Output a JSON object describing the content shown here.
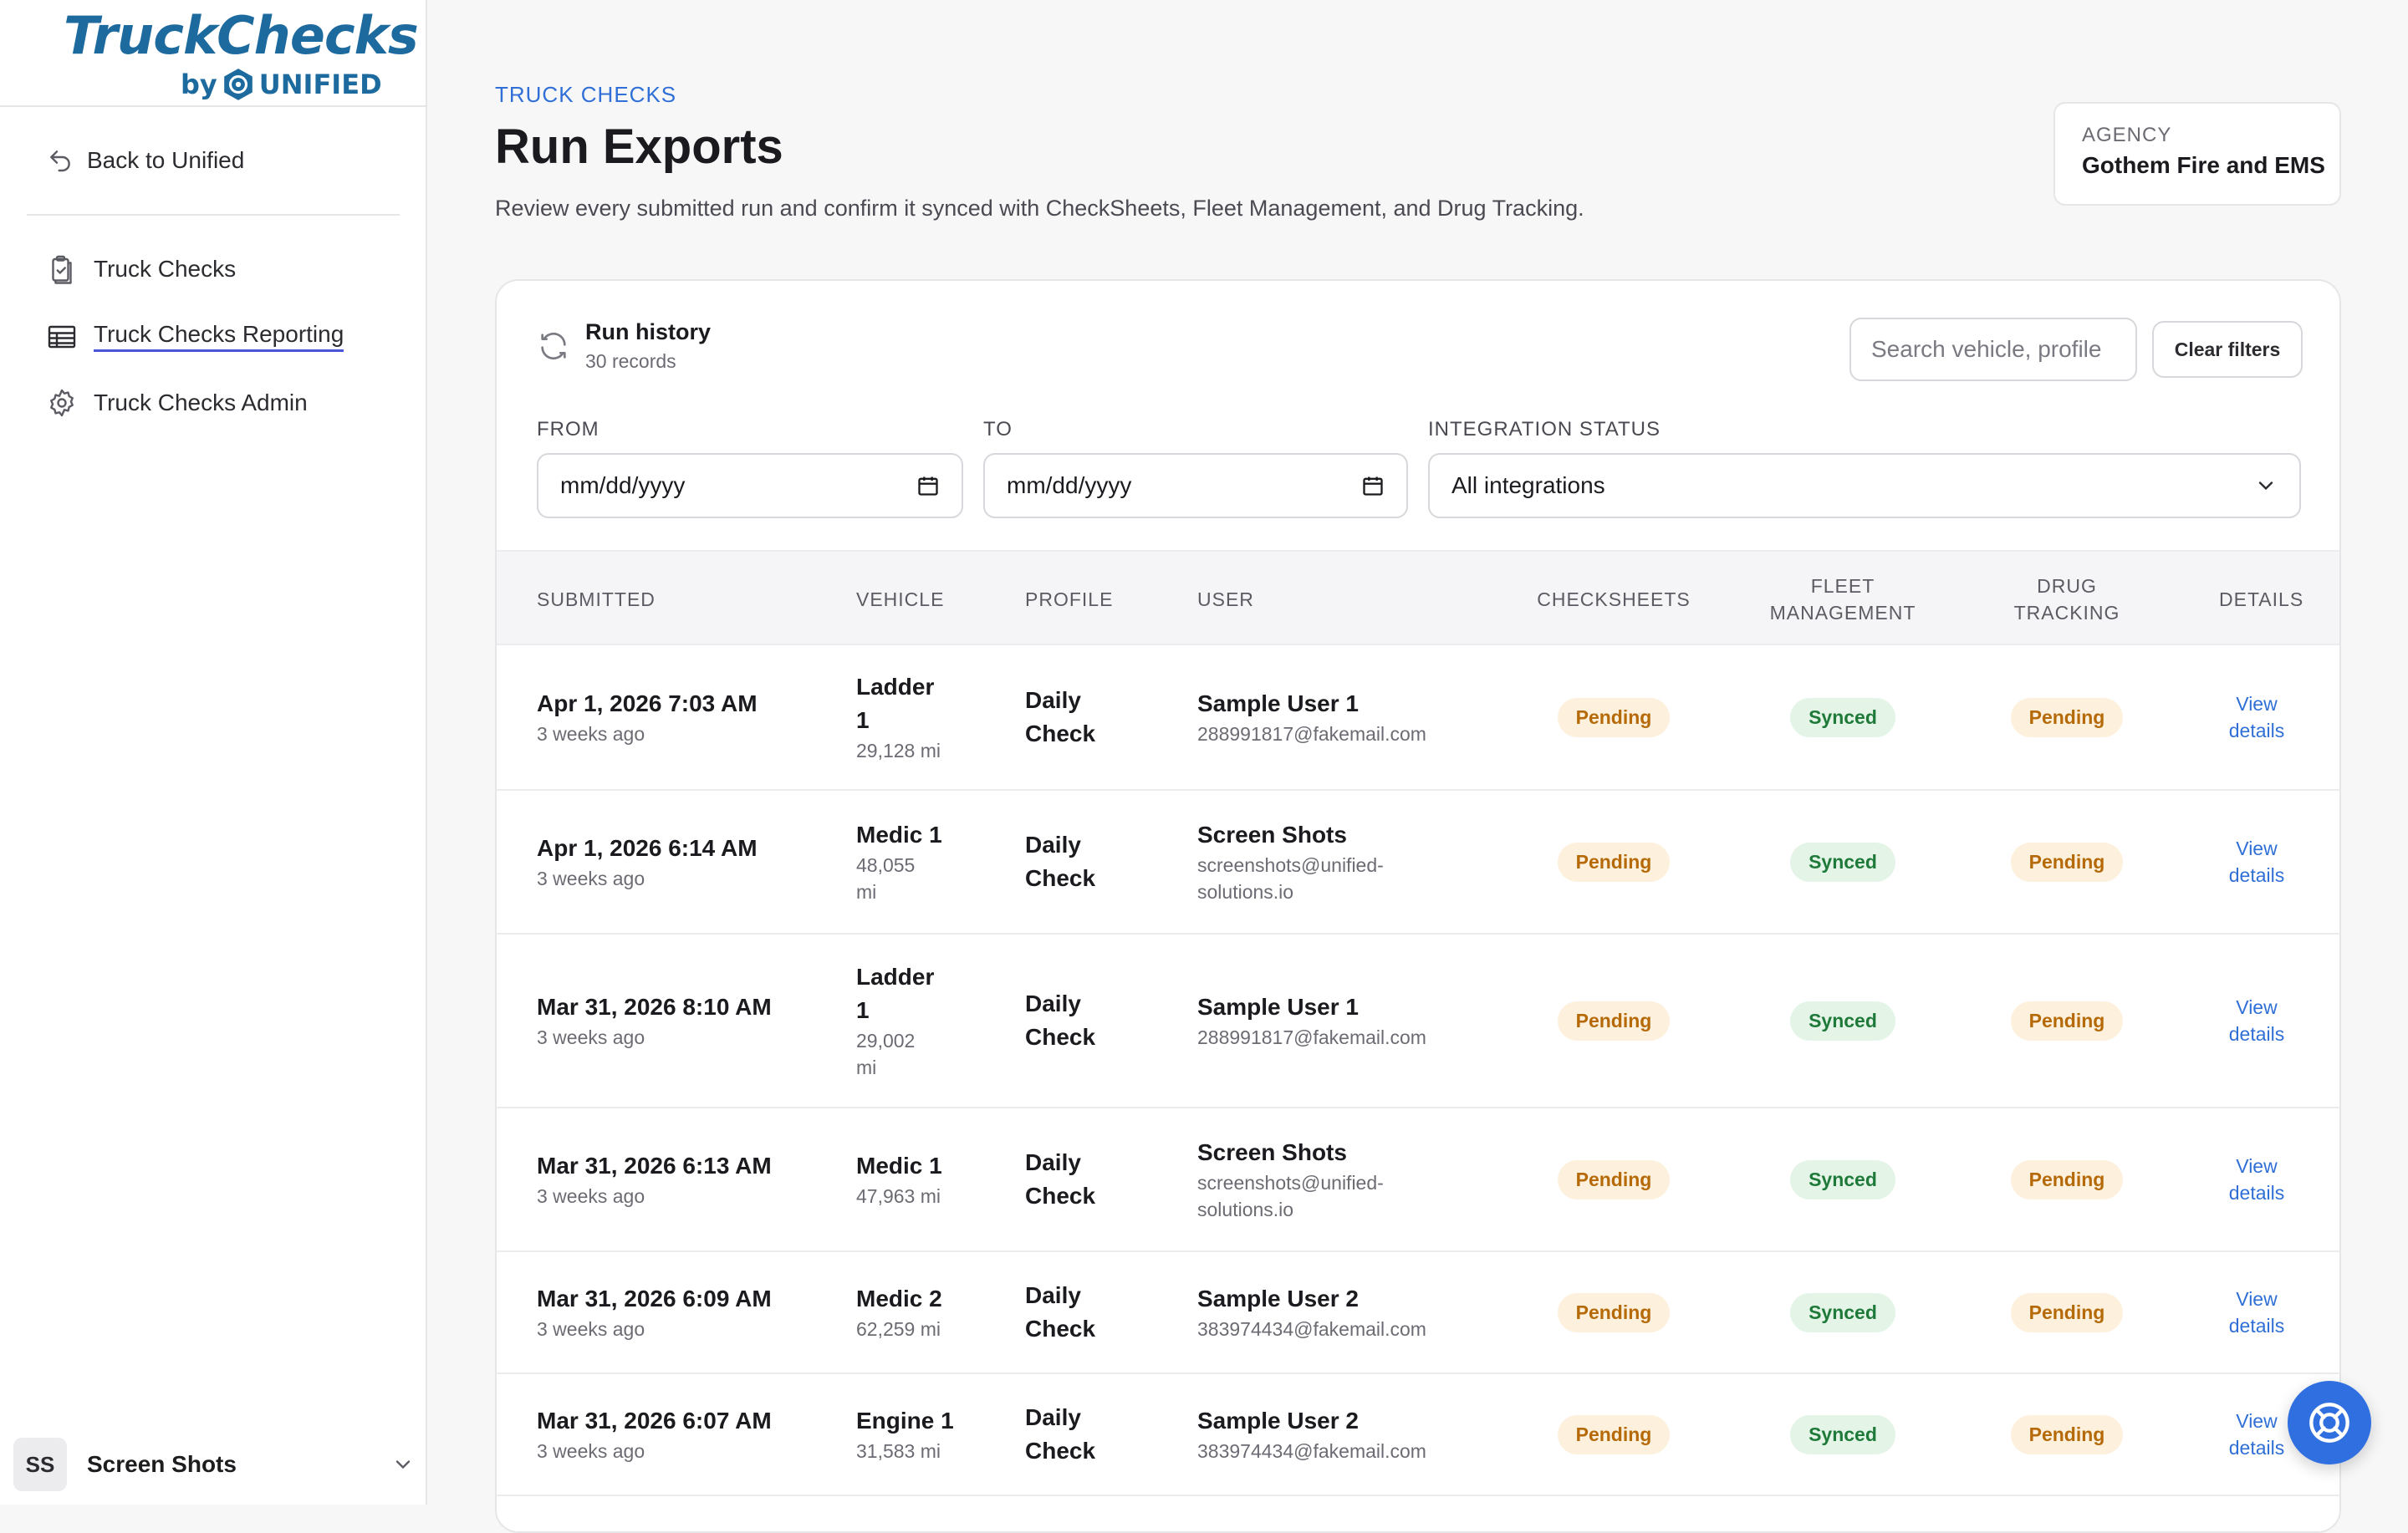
{
  "brand": {
    "name": "TruckChecks",
    "by": "by",
    "company": "UNIFIED"
  },
  "sidebar": {
    "back_label": "Back to Unified",
    "items": [
      {
        "label": "Truck Checks",
        "icon": "clipboard-check-icon",
        "active": false
      },
      {
        "label": "Truck Checks Reporting",
        "icon": "table-icon",
        "active": true
      },
      {
        "label": "Truck Checks Admin",
        "icon": "gear-icon",
        "active": false
      }
    ],
    "user": {
      "initials": "SS",
      "name": "Screen Shots"
    }
  },
  "header": {
    "eyebrow": "TRUCK CHECKS",
    "title": "Run Exports",
    "subtitle": "Review every submitted run and confirm it synced with CheckSheets, Fleet Management, and Drug Tracking.",
    "agency_label": "AGENCY",
    "agency_value": "Gothem Fire and EMS"
  },
  "history": {
    "title": "Run history",
    "count": "30 records",
    "search_placeholder": "Search vehicle, profile",
    "clear_label": "Clear filters"
  },
  "filters": {
    "from_label": "FROM",
    "from_value": "mm/dd/yyyy",
    "to_label": "TO",
    "to_value": "mm/dd/yyyy",
    "status_label": "INTEGRATION STATUS",
    "status_value": "All integrations"
  },
  "table": {
    "columns": {
      "submitted": "SUBMITTED",
      "vehicle": "VEHICLE",
      "profile": "PROFILE",
      "user": "USER",
      "checksheets": "CHECKSHEETS",
      "fleet_1": "FLEET",
      "fleet_2": "MANAGEMENT",
      "drug_1": "DRUG",
      "drug_2": "TRACKING",
      "details": "DETAILS"
    },
    "rows": [
      {
        "date": "Apr 1, 2026 7:03 AM",
        "ago": "3 weeks ago",
        "vehicle_1": "Ladder",
        "vehicle_2": "1",
        "miles_1": "29,128 mi",
        "miles_2": "",
        "profile_1": "Daily",
        "profile_2": "Check",
        "user": "Sample User 1",
        "email_1": "288991817@fakemail.com",
        "email_2": "",
        "checksheets": "Pending",
        "fleet": "Synced",
        "drug": "Pending",
        "view_1": "View",
        "view_2": "details"
      },
      {
        "date": "Apr 1, 2026 6:14 AM",
        "ago": "3 weeks ago",
        "vehicle_1": "Medic 1",
        "vehicle_2": "",
        "miles_1": "48,055",
        "miles_2": "mi",
        "profile_1": "Daily",
        "profile_2": "Check",
        "user": "Screen Shots",
        "email_1": "screenshots@unified-",
        "email_2": "solutions.io",
        "checksheets": "Pending",
        "fleet": "Synced",
        "drug": "Pending",
        "view_1": "View",
        "view_2": "details"
      },
      {
        "date": "Mar 31, 2026 8:10 AM",
        "ago": "3 weeks ago",
        "vehicle_1": "Ladder",
        "vehicle_2": "1",
        "miles_1": "29,002",
        "miles_2": "mi",
        "profile_1": "Daily",
        "profile_2": "Check",
        "user": "Sample User 1",
        "email_1": "288991817@fakemail.com",
        "email_2": "",
        "checksheets": "Pending",
        "fleet": "Synced",
        "drug": "Pending",
        "view_1": "View",
        "view_2": "details"
      },
      {
        "date": "Mar 31, 2026 6:13 AM",
        "ago": "3 weeks ago",
        "vehicle_1": "Medic 1",
        "vehicle_2": "",
        "miles_1": "47,963 mi",
        "miles_2": "",
        "profile_1": "Daily",
        "profile_2": "Check",
        "user": "Screen Shots",
        "email_1": "screenshots@unified-",
        "email_2": "solutions.io",
        "checksheets": "Pending",
        "fleet": "Synced",
        "drug": "Pending",
        "view_1": "View",
        "view_2": "details"
      },
      {
        "date": "Mar 31, 2026 6:09 AM",
        "ago": "3 weeks ago",
        "vehicle_1": "Medic 2",
        "vehicle_2": "",
        "miles_1": "62,259 mi",
        "miles_2": "",
        "profile_1": "Daily",
        "profile_2": "Check",
        "user": "Sample User 2",
        "email_1": "383974434@fakemail.com",
        "email_2": "",
        "checksheets": "Pending",
        "fleet": "Synced",
        "drug": "Pending",
        "view_1": "View",
        "view_2": "details"
      },
      {
        "date": "Mar 31, 2026 6:07 AM",
        "ago": "3 weeks ago",
        "vehicle_1": "Engine 1",
        "vehicle_2": "",
        "miles_1": "31,583 mi",
        "miles_2": "",
        "profile_1": "Daily",
        "profile_2": "Check",
        "user": "Sample User 2",
        "email_1": "383974434@fakemail.com",
        "email_2": "",
        "checksheets": "Pending",
        "fleet": "Synced",
        "drug": "Pending",
        "view_1": "View",
        "view_2": "details"
      }
    ]
  },
  "colors": {
    "accent": "#2f6fd6",
    "brand": "#1d6a9e",
    "pending": "#b56a07",
    "synced": "#1f7a3a"
  },
  "help_icon": "help-circle-icon"
}
